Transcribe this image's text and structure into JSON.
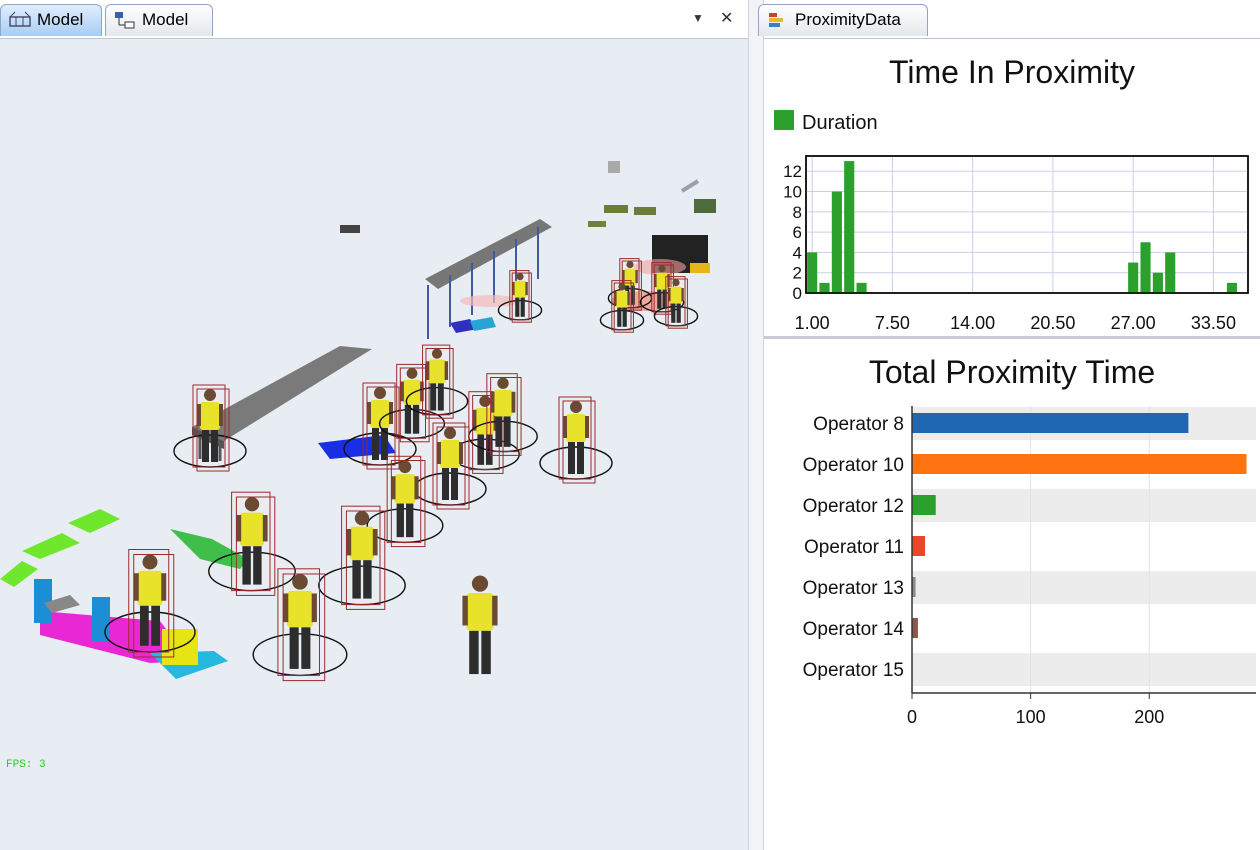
{
  "left_tabs": [
    {
      "label": "Model",
      "icon": "3d-model-icon",
      "active": true
    },
    {
      "label": "Model",
      "icon": "tree-view-icon",
      "active": false
    }
  ],
  "tab_controls": {
    "dropdown": "▼",
    "close": "✕"
  },
  "right_tab": {
    "label": "ProximityData",
    "icon": "chart-icon"
  },
  "viewport": {
    "fps": "FPS: 3"
  },
  "histogram": {
    "chart_data": {
      "type": "bar",
      "title": "Time In Proximity",
      "series": [
        {
          "name": "Duration",
          "color": "#2ca02c",
          "x": [
            1,
            2,
            3,
            4,
            5,
            27,
            28,
            29,
            30,
            31,
            35
          ],
          "values": [
            4,
            1,
            10,
            13,
            1,
            3,
            5,
            2,
            4,
            0,
            1
          ]
        }
      ],
      "x_ticks": [
        "1.00",
        "7.50",
        "14.00",
        "20.50",
        "27.00",
        "33.50"
      ],
      "y_ticks": [
        "0",
        "2",
        "4",
        "6",
        "8",
        "10",
        "12"
      ],
      "ylim": [
        0,
        13.5
      ],
      "grid": true
    }
  },
  "totals": {
    "chart_data": {
      "type": "bar",
      "orientation": "horizontal",
      "title": "Total Proximity Time",
      "categories": [
        "Operator 8",
        "Operator 10",
        "Operator 12",
        "Operator 11",
        "Operator 13",
        "Operator 14",
        "Operator 15"
      ],
      "values": [
        233,
        282,
        20,
        11,
        3,
        5,
        0
      ],
      "colors": [
        "#1f67b1",
        "#ff7311",
        "#2ca02c",
        "#e8472a",
        "#8a8a8a",
        "#8c564b",
        "#cccccc"
      ],
      "x_ticks": [
        "0",
        "100",
        "200"
      ],
      "xlim": [
        0,
        290
      ]
    }
  }
}
